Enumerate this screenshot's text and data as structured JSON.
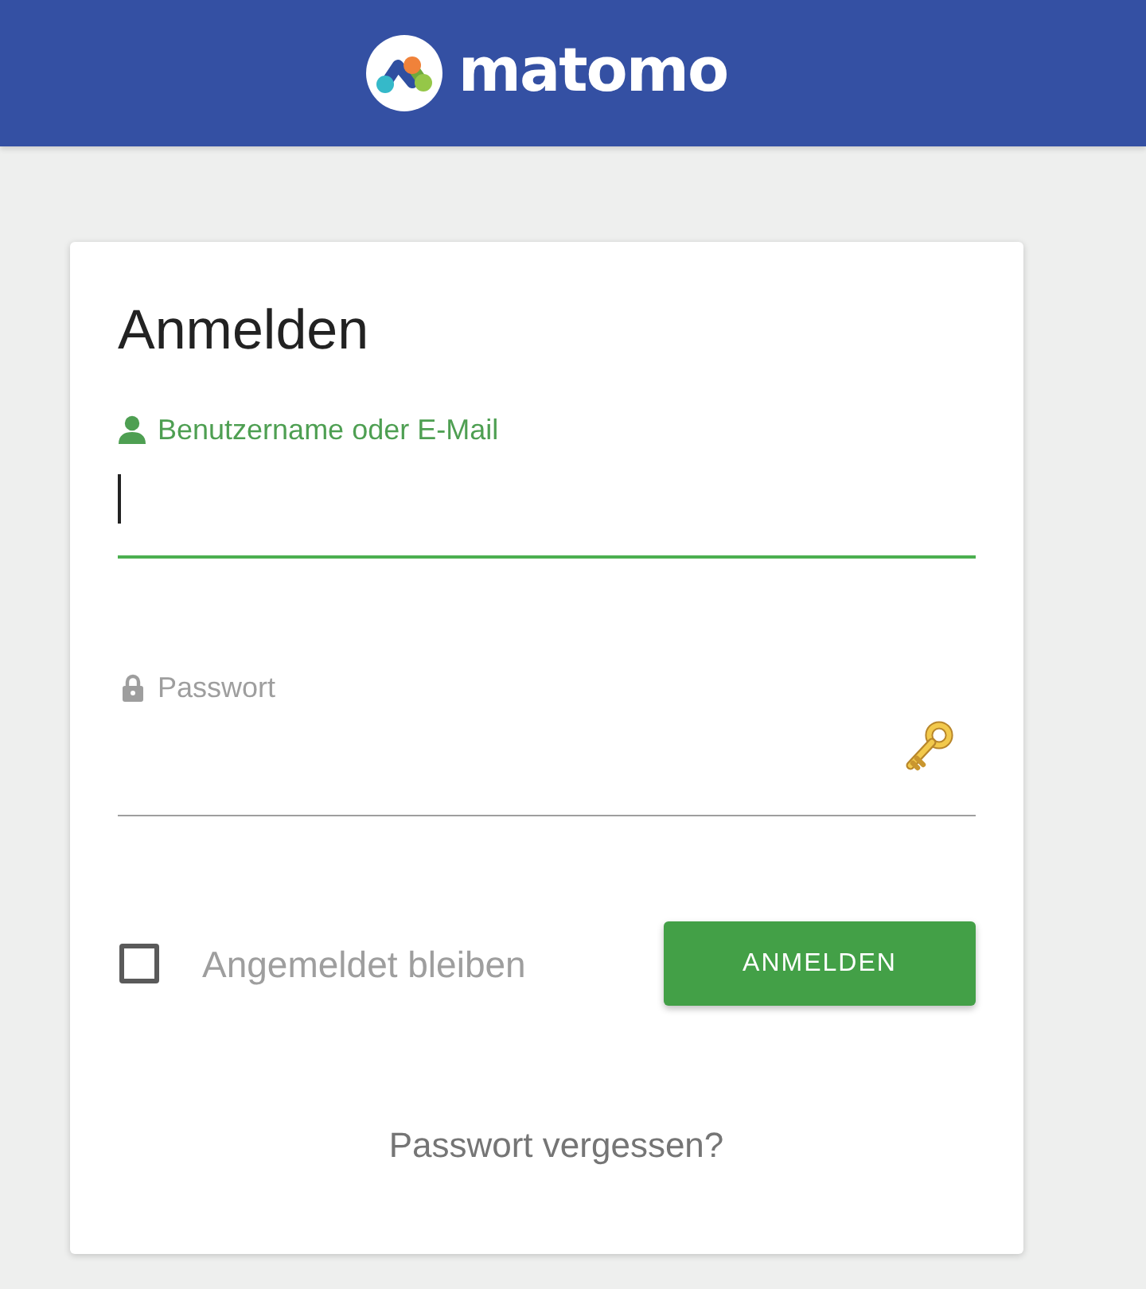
{
  "header": {
    "logo_text": "matomo"
  },
  "login_form": {
    "title": "Anmelden",
    "fields": [
      {
        "kind": "text",
        "label": "Benutzername oder E-Mail",
        "focused": true
      },
      {
        "kind": "password",
        "label": "Passwort",
        "focused": false
      }
    ],
    "remember_me": {
      "label": "Angemeldet bleiben",
      "checked": false
    },
    "submit_button": "ANMELDEN",
    "forgot_password_link": "Passwort vergessen?"
  }
}
